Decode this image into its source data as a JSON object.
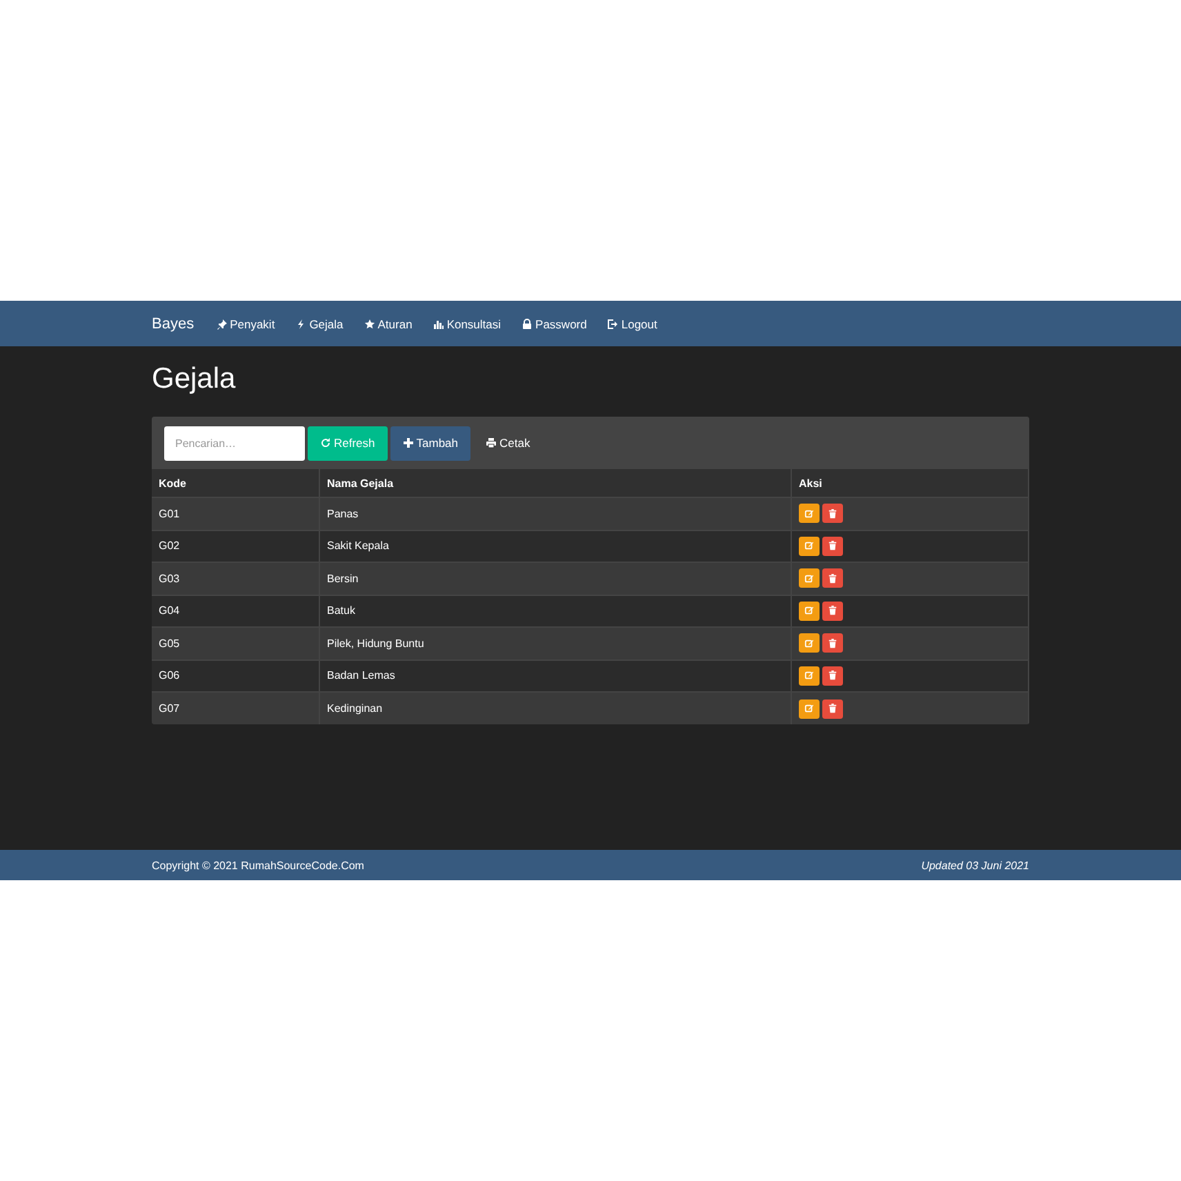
{
  "navbar": {
    "brand": "Bayes",
    "items": [
      {
        "kind": "pin",
        "label": "Penyakit"
      },
      {
        "kind": "bolt",
        "label": "Gejala"
      },
      {
        "kind": "star",
        "label": "Aturan"
      },
      {
        "kind": "chart",
        "label": "Konsultasi"
      },
      {
        "kind": "lock",
        "label": "Password"
      },
      {
        "kind": "logout",
        "label": "Logout"
      }
    ]
  },
  "page_title": "Gejala",
  "toolbar": {
    "search": {
      "placeholder": "Pencarian…"
    },
    "buttons": [
      {
        "kind": "refresh",
        "label": "Refresh"
      },
      {
        "kind": "add",
        "label": "Tambah"
      },
      {
        "kind": "print",
        "label": "Cetak"
      }
    ]
  },
  "table": {
    "columns": [
      "Kode",
      "Nama Gejala",
      "Aksi"
    ],
    "rows": [
      {
        "kode": "G01",
        "nama": "Panas"
      },
      {
        "kode": "G02",
        "nama": "Sakit Kepala"
      },
      {
        "kode": "G03",
        "nama": "Bersin"
      },
      {
        "kode": "G04",
        "nama": "Batuk"
      },
      {
        "kode": "G05",
        "nama": "Pilek, Hidung Buntu"
      },
      {
        "kode": "G06",
        "nama": "Badan Lemas"
      },
      {
        "kode": "G07",
        "nama": "Kedinginan"
      }
    ]
  },
  "footer": {
    "copyright": "Copyright © 2021 RumahSourceCode.Com",
    "updated": "Updated 03 Juni 2021"
  }
}
